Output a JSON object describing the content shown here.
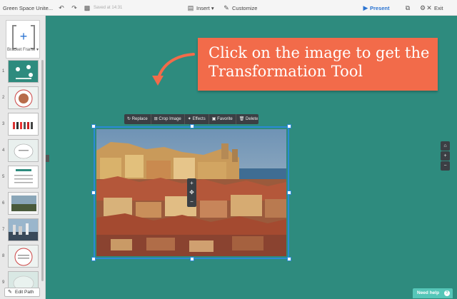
{
  "topbar": {
    "title": "Green Space Unite...",
    "saved": "Saved at 14:31",
    "insert": "Insert",
    "customize": "Customize",
    "present": "Present",
    "exit": "Exit"
  },
  "sidebar": {
    "frame_label": "Bracket Frame",
    "frame_icon": "plus",
    "thumbnails": [
      "1",
      "2",
      "3",
      "4",
      "5",
      "6",
      "7",
      "8",
      "9"
    ],
    "edit_path": "Edit Path"
  },
  "callout": {
    "text": "Click on the image to get the Transformation Tool"
  },
  "image_toolbar": {
    "replace": "Replace",
    "crop": "Crop Image",
    "effects": "Effects",
    "favorite": "Favorite",
    "delete": "Delete"
  },
  "help": {
    "label": "Need help"
  },
  "colors": {
    "canvas": "#2e8b7e",
    "callout": "#f26b4a",
    "selection": "#2a8ad6",
    "accent": "#2a73d1"
  }
}
